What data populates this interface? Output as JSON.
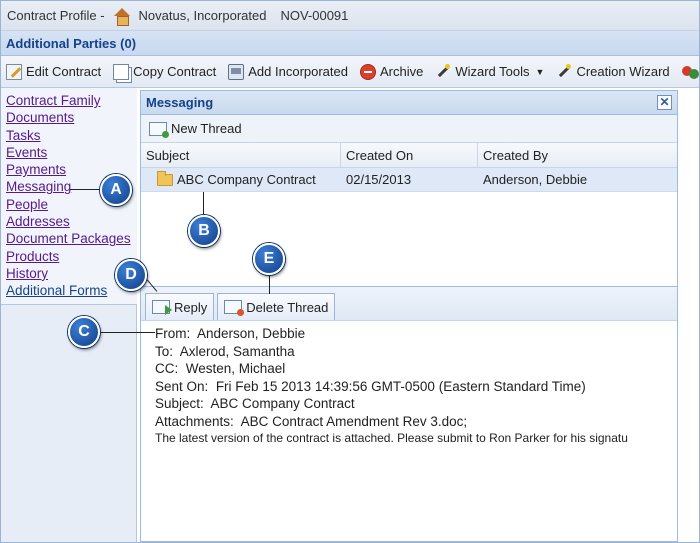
{
  "title_bar": {
    "label": "Contract Profile -",
    "company": "Novatus, Incorporated",
    "contract_id": "NOV-00091",
    "icon": "house-icon"
  },
  "parties_bar": {
    "label": "Additional Parties (0)"
  },
  "toolbar": {
    "edit_contract": "Edit Contract",
    "copy_contract": "Copy Contract",
    "add_incorporated": "Add Incorporated",
    "archive": "Archive",
    "wizard_tools": "Wizard Tools",
    "creation_wizard": "Creation Wizard"
  },
  "sidebar": {
    "items": [
      "Contract Family",
      "Documents",
      "Tasks",
      "Events",
      "Payments",
      "Messaging",
      "People",
      "Addresses",
      "Document Packages",
      "Products",
      "History",
      "Additional Forms"
    ]
  },
  "messaging": {
    "title": "Messaging",
    "close_symbol": "✕",
    "new_thread": "New Thread",
    "columns": {
      "subject": "Subject",
      "created_on": "Created On",
      "created_by": "Created By"
    },
    "rows": [
      {
        "subject": "ABC Company Contract",
        "created_on": "02/15/2013",
        "created_by": "Anderson, Debbie"
      }
    ],
    "reply": "Reply",
    "delete_thread": "Delete Thread",
    "message": {
      "from_label": "From:",
      "from": "Anderson, Debbie",
      "to_label": "To:",
      "to": "Axlerod, Samantha",
      "cc_label": "CC:",
      "cc": "Westen, Michael",
      "sent_label": "Sent On:",
      "sent": "Fri Feb 15 2013 14:39:56 GMT-0500 (Eastern Standard Time)",
      "subject_label": "Subject:",
      "subject": "ABC Company Contract",
      "attachments_label": "Attachments:",
      "attachments": "ABC Contract Amendment Rev 3.doc;",
      "body": "The latest version of the contract is attached. Please submit to Ron Parker for his signatu"
    }
  },
  "callouts": {
    "a": "A",
    "b": "B",
    "c": "C",
    "d": "D",
    "e": "E"
  }
}
